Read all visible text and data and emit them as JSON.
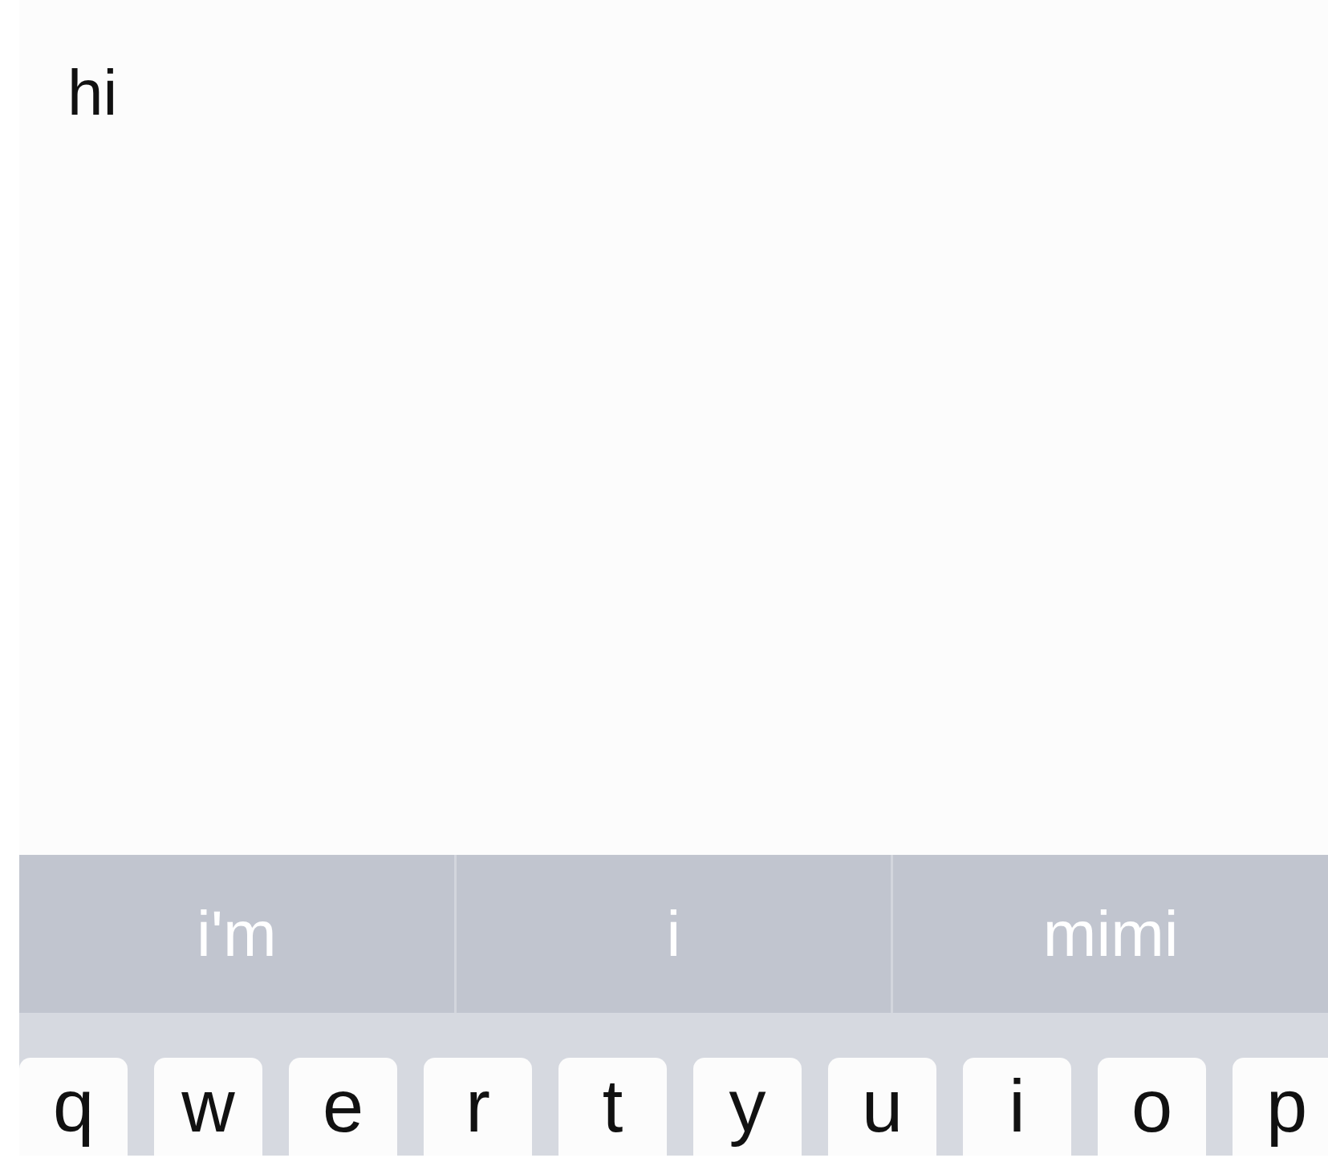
{
  "note": {
    "text": "hi"
  },
  "suggestions": [
    "i'm",
    "i",
    "mimi"
  ],
  "keyboard": {
    "keys": [
      "q",
      "w",
      "e",
      "r",
      "t",
      "y",
      "u",
      "i",
      "o",
      "p"
    ]
  }
}
